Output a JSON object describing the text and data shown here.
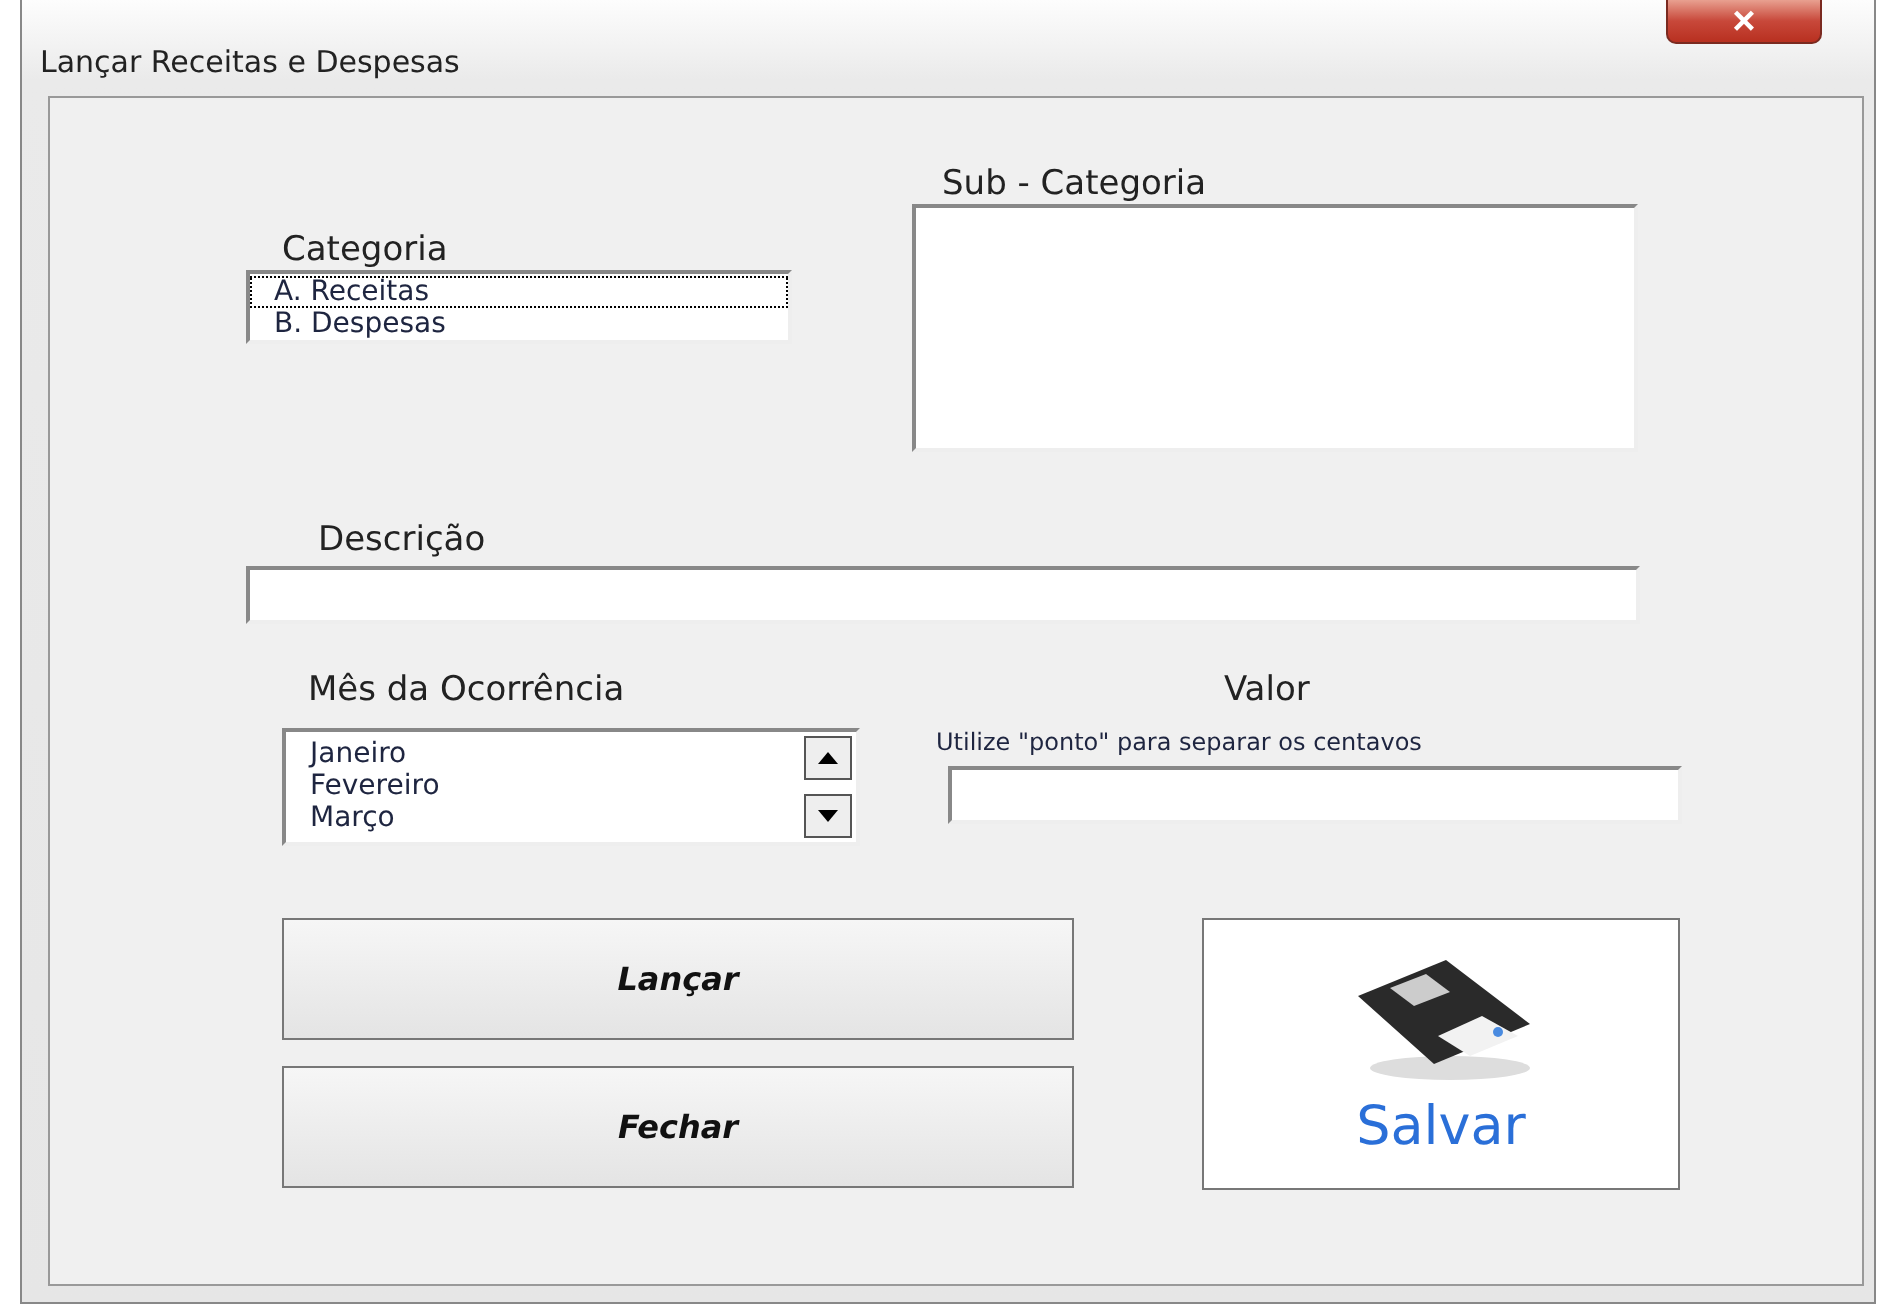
{
  "window": {
    "title": "Lançar Receitas e Despesas",
    "close": "×"
  },
  "categoria": {
    "label": "Categoria",
    "items": [
      {
        "label": "A. Receitas",
        "selected": true
      },
      {
        "label": "B. Despesas",
        "selected": false
      }
    ]
  },
  "sub_categoria": {
    "label": "Sub - Categoria"
  },
  "descricao": {
    "label": "Descrição"
  },
  "mes": {
    "label": "Mês da Ocorrência",
    "items": [
      {
        "label": "Janeiro",
        "selected": false
      },
      {
        "label": "Fevereiro",
        "selected": false
      },
      {
        "label": "Março",
        "selected": false
      }
    ]
  },
  "valor": {
    "label": "Valor",
    "hint": "Utilize \"ponto\" para separar os centavos"
  },
  "buttons": [
    {
      "label": "Lançar"
    },
    {
      "label": "Fechar"
    }
  ],
  "save_button": {
    "label": "Salvar"
  }
}
